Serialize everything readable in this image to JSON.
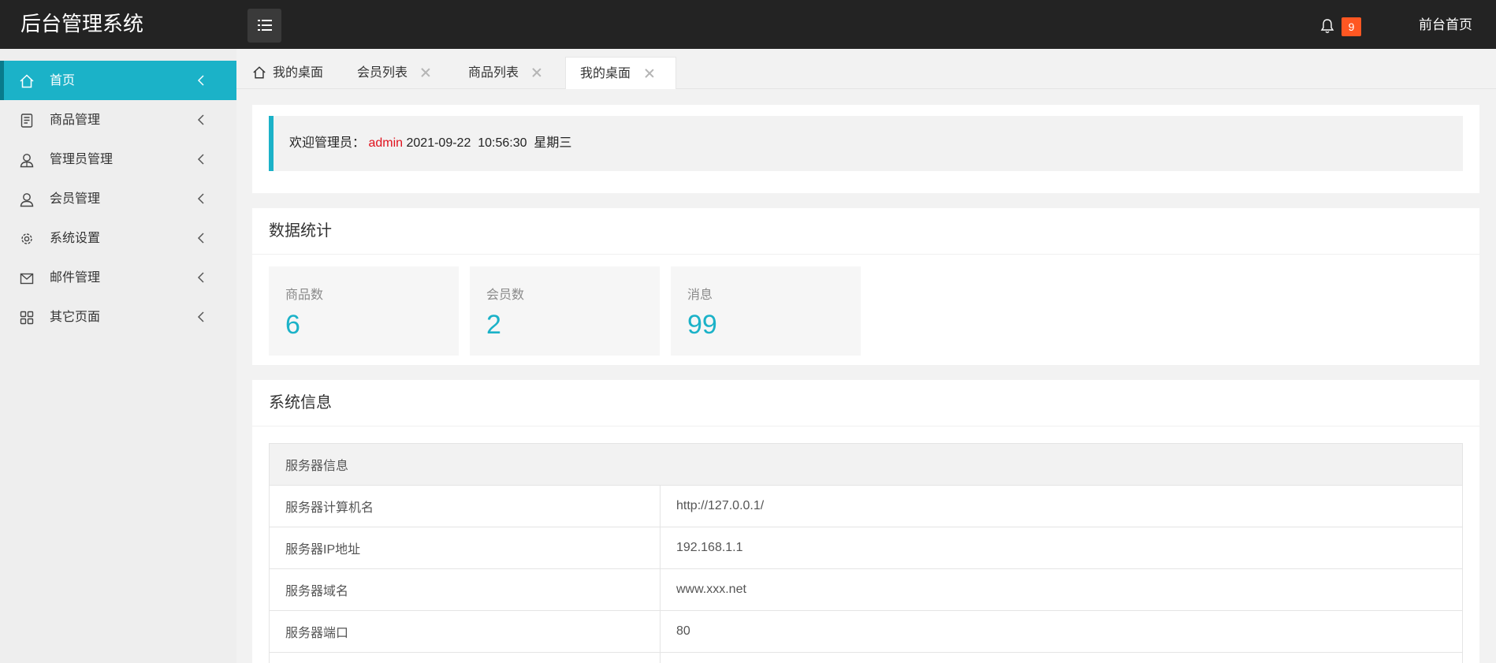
{
  "header": {
    "title": "后台管理系统",
    "notification_count": "9",
    "home_link": "前台首页"
  },
  "sidebar": {
    "items": [
      {
        "label": "首页",
        "icon": "home-icon"
      },
      {
        "label": "商品管理",
        "icon": "document-icon"
      },
      {
        "label": "管理员管理",
        "icon": "user-admin-icon"
      },
      {
        "label": "会员管理",
        "icon": "user-icon"
      },
      {
        "label": "系统设置",
        "icon": "gear-icon"
      },
      {
        "label": "邮件管理",
        "icon": "mail-icon"
      },
      {
        "label": "其它页面",
        "icon": "grid-icon"
      }
    ]
  },
  "tabs": [
    {
      "label": "我的桌面"
    },
    {
      "label": "会员列表"
    },
    {
      "label": "商品列表"
    },
    {
      "label": "我的桌面"
    }
  ],
  "welcome": {
    "prefix": "欢迎管理员：",
    "user": "admin",
    "datetime": "2021-09-22  10:56:30  星期三"
  },
  "stats": {
    "title": "数据统计",
    "items": [
      {
        "label": "商品数",
        "value": "6"
      },
      {
        "label": "会员数",
        "value": "2"
      },
      {
        "label": "消息",
        "value": "99"
      }
    ]
  },
  "sysinfo": {
    "title": "系统信息",
    "header": "服务器信息",
    "rows": [
      {
        "key": "服务器计算机名",
        "value": "http://127.0.0.1/"
      },
      {
        "key": "服务器IP地址",
        "value": "192.168.1.1"
      },
      {
        "key": "服务器域名",
        "value": "www.xxx.net"
      },
      {
        "key": "服务器端口",
        "value": "80"
      }
    ]
  },
  "colors": {
    "accent": "#1bb2c8",
    "header_bg": "#232323",
    "badge": "#ff5722",
    "admin_text": "#e0101c"
  }
}
